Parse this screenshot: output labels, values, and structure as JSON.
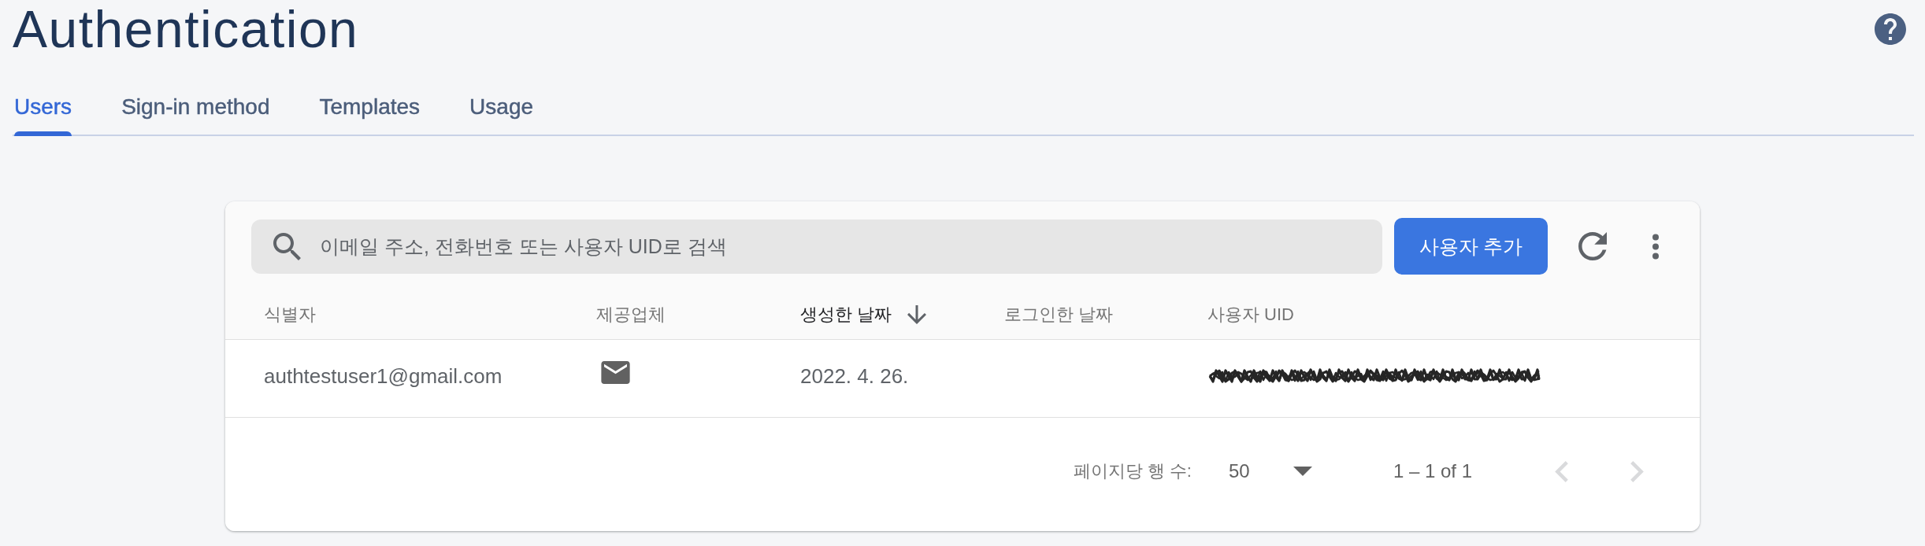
{
  "page": {
    "title": "Authentication"
  },
  "tabs": [
    {
      "label": "Users",
      "selected": true
    },
    {
      "label": "Sign-in method",
      "selected": false
    },
    {
      "label": "Templates",
      "selected": false
    },
    {
      "label": "Usage",
      "selected": false
    }
  ],
  "toolbar": {
    "search": {
      "placeholder": "이메일 주소, 전화번호 또는 사용자 UID로 검색"
    },
    "add_button": "사용자 추가"
  },
  "table": {
    "columns": [
      {
        "label": "식별자",
        "sorted": false
      },
      {
        "label": "제공업체",
        "sorted": false
      },
      {
        "label": "생성한 날짜",
        "sorted": true
      },
      {
        "label": "로그인한 날짜",
        "sorted": false
      },
      {
        "label": "사용자 UID",
        "sorted": false
      }
    ],
    "rows": [
      {
        "identifier": "authtestuser1@gmail.com",
        "created": "2022. 4. 26.",
        "uid_redacted": true
      }
    ]
  },
  "pagination": {
    "rows_per_page_label": "페이지당 행 수:",
    "rows_per_page": "50",
    "range": "1 – 1 of 1",
    "previous": {
      "disabled": true
    },
    "next": {
      "disabled": true
    }
  }
}
